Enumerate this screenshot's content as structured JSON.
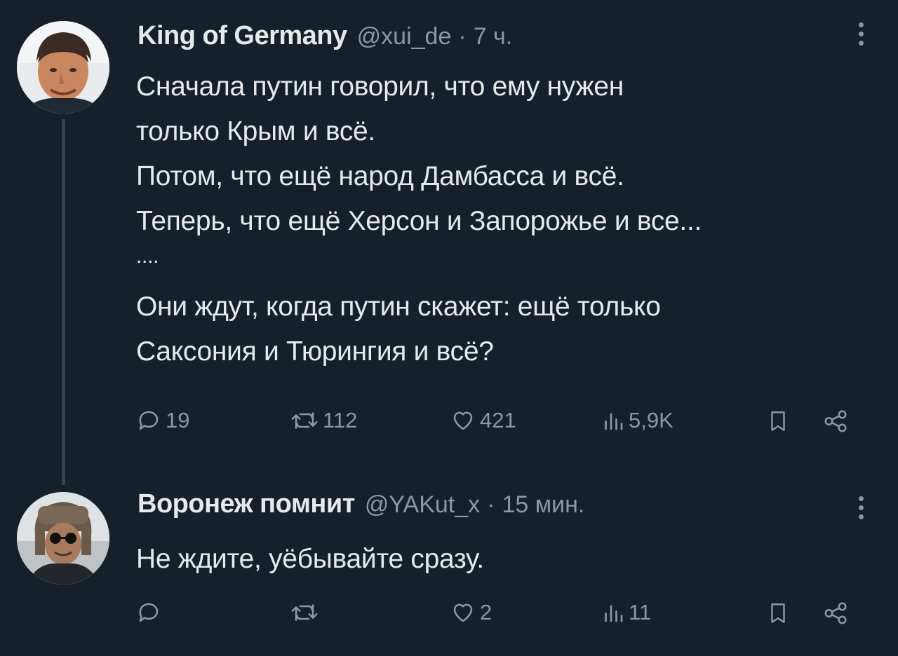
{
  "tweets": [
    {
      "display_name": "King of Germany",
      "handle": "@xui_de",
      "separator": "·",
      "time": "7 ч.",
      "text_lines": [
        "Сначала путин говорил, что ему нужен",
        "только Крым и всё.",
        "Потом, что ещё народ Дамбасса и всё.",
        "Теперь, что ещё Херсон и Запорожье и все...",
        "....",
        "Они ждут, когда путин скажет: ещё только",
        "Саксония и Тюрингия и всё?"
      ],
      "actions": {
        "replies": "19",
        "retweets": "112",
        "likes": "421",
        "views": "5,9K"
      }
    },
    {
      "display_name": "Воронеж помнит",
      "handle": "@YAKut_x",
      "separator": "·",
      "time": "15 мин.",
      "text_lines": [
        "Не ждите, уёбывайте сразу."
      ],
      "actions": {
        "replies": "",
        "retweets": "",
        "likes": "2",
        "views": "11"
      }
    }
  ],
  "theme": {
    "background": "#15202b",
    "text": "#e7e9ea",
    "secondary": "#8b98a5",
    "thread_line": "#38444d"
  },
  "icons": [
    "reply-icon",
    "retweet-icon",
    "like-icon",
    "views-icon",
    "bookmark-icon",
    "share-icon",
    "more-icon"
  ]
}
